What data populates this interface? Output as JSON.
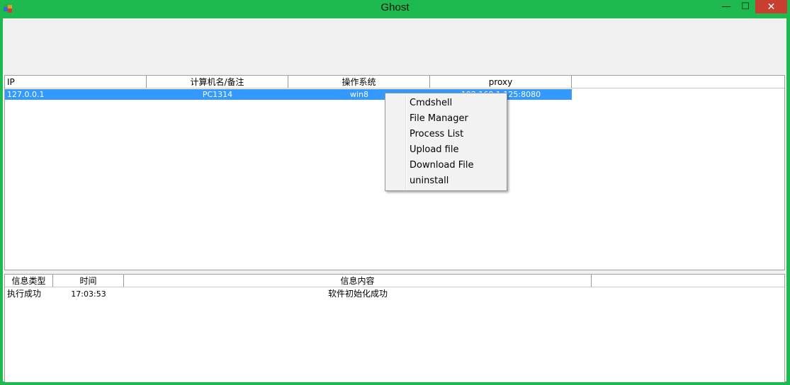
{
  "window": {
    "title": "Ghost",
    "minimize": "—",
    "maximize": "☐",
    "close": "✕"
  },
  "hosts": {
    "columns": [
      "IP",
      "计算机名/备注",
      "操作系统",
      "proxy"
    ],
    "rows": [
      {
        "ip": "127.0.0.1",
        "name": "PC1314",
        "os": "win8",
        "proxy": "192.168.1.125:8080"
      }
    ]
  },
  "context_menu": {
    "items": [
      "Cmdshell",
      "File Manager",
      "Process List",
      "Upload file",
      "Download File",
      "uninstall"
    ]
  },
  "log": {
    "columns": [
      "信息类型",
      "时间",
      "信息内容"
    ],
    "rows": [
      {
        "type": "执行成功",
        "time": "17:03:53",
        "content": "软件初始化成功"
      }
    ]
  },
  "colors": {
    "frame": "#1fba4f",
    "selection": "#3399ff",
    "close_button": "#c7402f"
  }
}
